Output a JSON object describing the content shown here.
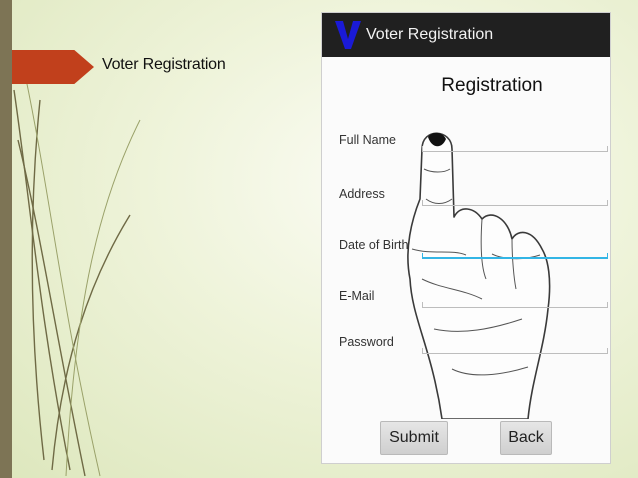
{
  "slide": {
    "title": "Voter Registration"
  },
  "app": {
    "logo_letter": "V",
    "title": "Voter Registration",
    "heading": "Registration"
  },
  "form": {
    "fields": [
      {
        "label": "Full Name",
        "value": ""
      },
      {
        "label": "Address",
        "value": ""
      },
      {
        "label": "Date of Birth",
        "value": "",
        "focused": true
      },
      {
        "label": "E-Mail",
        "value": ""
      },
      {
        "label": "Password",
        "value": ""
      }
    ]
  },
  "buttons": {
    "submit_label": "Submit",
    "back_label": "Back"
  },
  "colors": {
    "accent_bar": "#c1401c",
    "side_bar": "#7d7455",
    "action_bar": "#202020",
    "logo": "#1a1ad6",
    "focus_underline": "#33b5e5"
  },
  "icons": {
    "app_logo": "v-logo-icon",
    "finger": "inked-finger-icon"
  }
}
